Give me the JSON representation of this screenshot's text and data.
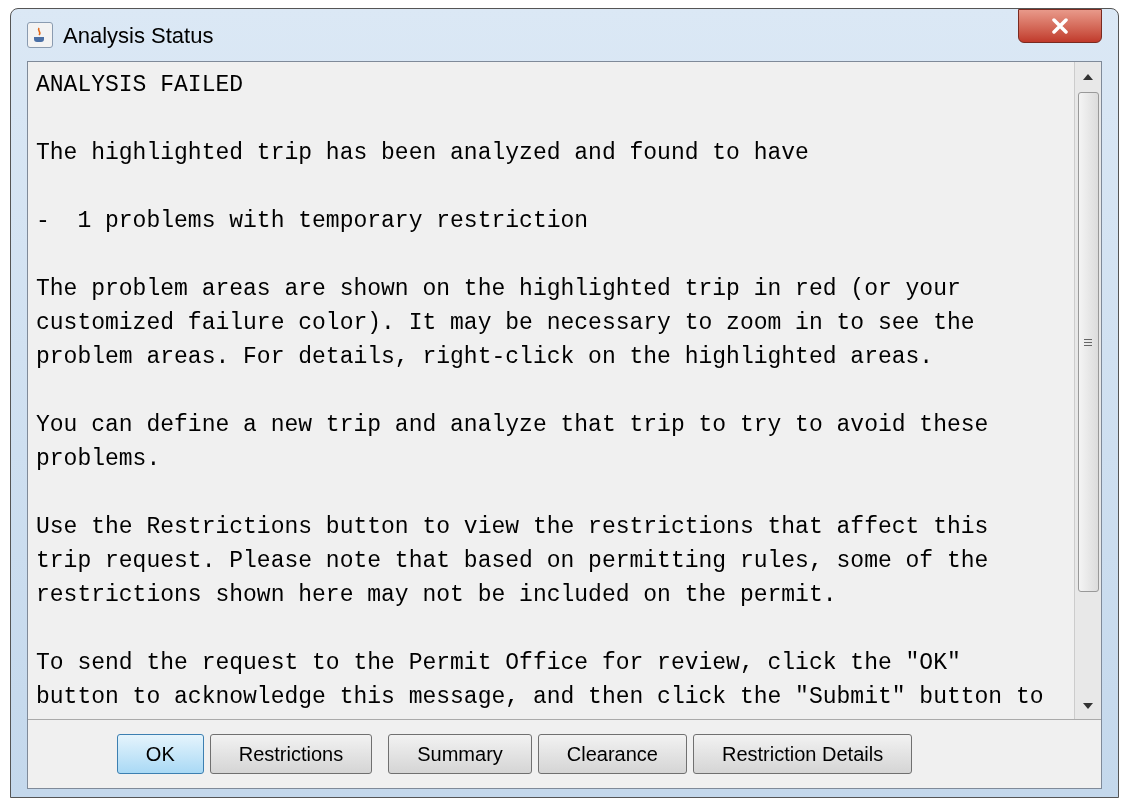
{
  "window": {
    "title": "Analysis Status"
  },
  "message": {
    "paragraphs": [
      [
        "ANALYSIS FAILED"
      ],
      [
        "The highlighted trip has been analyzed and found to have"
      ],
      [
        "-  1 problems with temporary restriction"
      ],
      [
        "The problem areas are shown on the highlighted trip in red (or your",
        "customized failure color). It may be necessary to zoom in to see the",
        "problem areas. For details, right-click on the highlighted areas."
      ],
      [
        "You can define a new trip and analyze that trip to try to avoid these",
        "problems."
      ],
      [
        "Use the Restrictions button to view the restrictions that affect this",
        "trip request. Please note that based on permitting rules, some of the",
        "restrictions shown here may not be included on the permit."
      ],
      [
        "To send the request to the Permit Office for review, click the \"OK\"",
        "button to acknowledge this message, and then click the \"Submit\" button to"
      ]
    ]
  },
  "buttons": [
    {
      "label": "OK",
      "selected": true
    },
    {
      "label": "Restrictions",
      "selected": false
    },
    {
      "label": "Summary",
      "selected": false
    },
    {
      "label": "Clearance",
      "selected": false
    },
    {
      "label": "Restriction Details",
      "selected": false
    }
  ]
}
